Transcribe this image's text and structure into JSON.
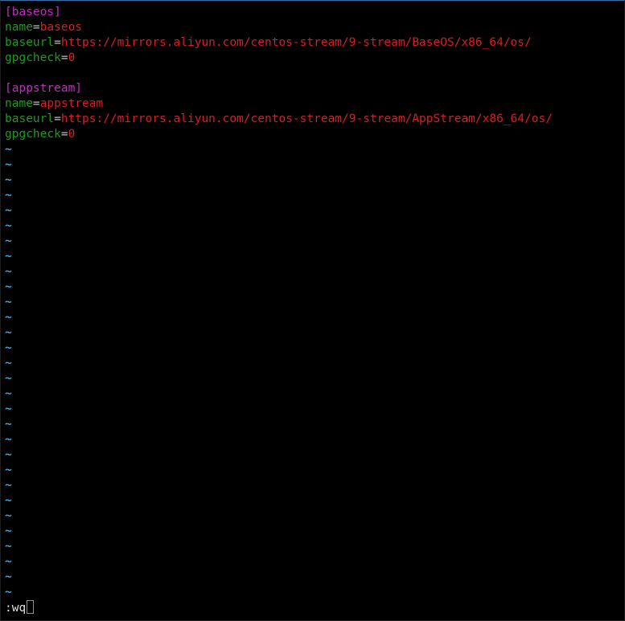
{
  "editor": {
    "lines": [
      {
        "section": "[baseos]"
      },
      {
        "key": "name",
        "eq": "=",
        "value": "baseos"
      },
      {
        "key": "baseurl",
        "eq": "=",
        "value": "https://mirrors.aliyun.com/centos-stream/9-stream/BaseOS/x86_64/os/"
      },
      {
        "key": "gpgcheck",
        "eq": "=",
        "value": "0"
      },
      {
        "blank": ""
      },
      {
        "section": "[appstream]"
      },
      {
        "key": "name",
        "eq": "=",
        "value": "appstream"
      },
      {
        "key": "baseurl",
        "eq": "=",
        "value": "https://mirrors.aliyun.com/centos-stream/9-stream/AppStream/x86_64/os/"
      },
      {
        "key": "gpgcheck",
        "eq": "=",
        "value": "0"
      }
    ],
    "filler": "~",
    "filler_count": 30
  },
  "command_line": {
    "text": ":wq"
  },
  "colors": {
    "background": "#000000",
    "section": "#c02cc0",
    "key": "#1f9a1f",
    "value": "#d81e1e",
    "tilde": "#3aa6e0",
    "cursor": "#1ee11e"
  }
}
